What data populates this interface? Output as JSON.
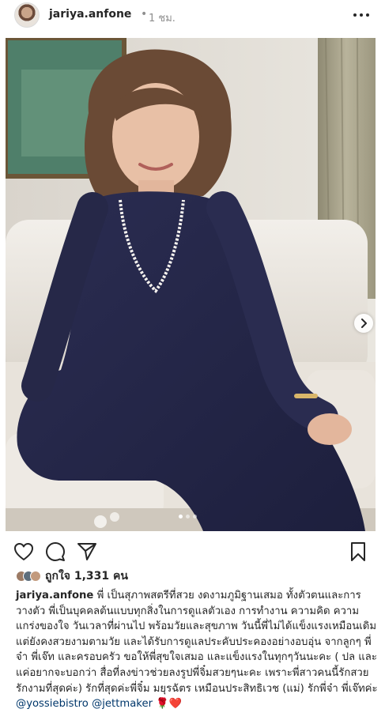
{
  "post": {
    "username": "jariya.anfone",
    "separator": "•",
    "time": "1 ชม."
  },
  "carousel": {
    "slide_count": 3,
    "active_index": 0
  },
  "likes": {
    "label": "ถูกใจ 1,331 คน"
  },
  "caption": {
    "username": "jariya.anfone",
    "text": "พี่ เป็นสุภาพสตรีที่สวย งดงามภูมิฐานเสมอ ทั้งตัวตนและการวางตัว พี่เป็นบุคคลต้นแบบทุกสิ่งในการดูแลตัวเอง การทำงาน ความคิด ความแกร่งของใจ วันเวลาที่ผ่านไป พร้อมวัยและสุขภาพ วันนี้พี่ไม่ได้แข็งแรงเหมือนเดิม แต่ยังคงสวยงามตามวัย และได้รับการดูแลประคับประคองอย่างอบอุ่น จากลูกๆ พี่จ๋า พี่เจ๊ท และครอบครัว ขอให้พี่สุขใจเสมอ และแข็งแรงในทุกๆวันนะคะ ( ปล และแค่อยากจะบอกว่า สื่อที่ลงข่าวช่วยลงรูปพี่จิ๋มสวยๆนะคะ เพราะพี่สาวคนนี้รักสวยรักงามที่สุดค่ะ) รักที่สุดค่ะพี่จิ๋ม มยุรฉัตร เหมือนประสิทธิเวช (แม่) รักพี่จ๋า พี่เจ๊ทค่ะ",
    "mention_1": "@yossiebistro",
    "mention_2": "@jettmaker",
    "emoji": "🌹❤️"
  },
  "icons": {
    "more": "more-options-icon",
    "like": "heart-icon",
    "comment": "comment-icon",
    "share": "paper-plane-icon",
    "save": "bookmark-icon",
    "next": "chevron-right-icon"
  }
}
